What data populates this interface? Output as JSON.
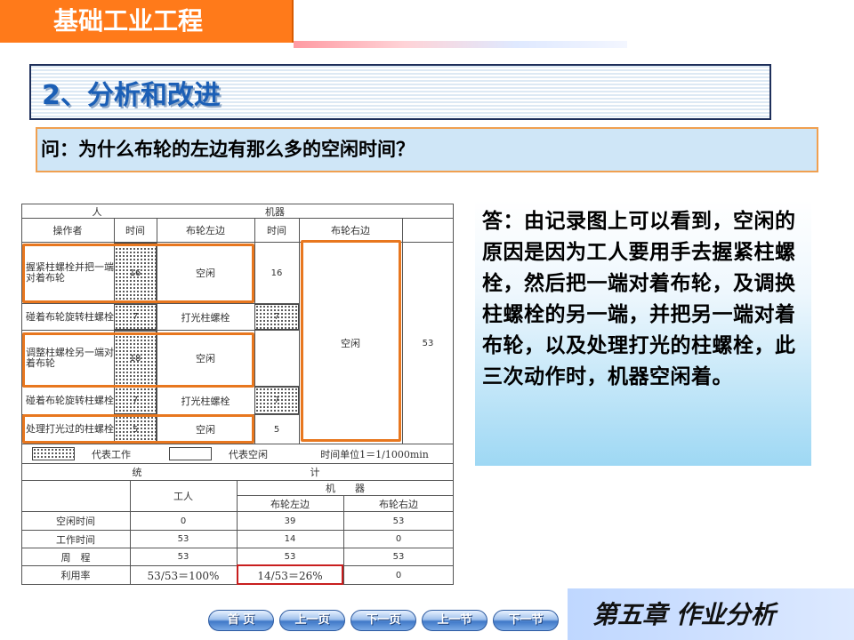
{
  "course_title": "基础工业工程",
  "section_title": "2、分析和改进",
  "question": "问：为什么布轮的左边有那么多的空闲时间？",
  "answer": "答：由记录图上可以看到，空闲的原因是因为工人要用手去握紧柱螺栓，然后把一端对着布轮，及调换柱螺栓的另一端，并把另一端对着布轮，以及处理打光的柱螺栓，此三次动作时，机器空闲着。",
  "chart": {
    "header": {
      "worker": "人",
      "machine": "机器",
      "operator": "操作者",
      "time": "时间",
      "wheel_left": "布轮左边",
      "time2": "时间",
      "wheel_right": "布轮右边"
    },
    "rows": [
      {
        "op": "握紧柱螺栓并把一端对着布轮",
        "t": "16",
        "left": "空闲",
        "t2": "16"
      },
      {
        "op": "碰着布轮旋转柱螺栓",
        "t": "7",
        "left": "打光柱螺栓",
        "t2": "7"
      },
      {
        "op": "调整柱螺栓另一端对着布轮",
        "t": "18",
        "left": "空闲",
        "t2": ""
      },
      {
        "op": "碰着布轮旋转柱螺栓",
        "t": "7",
        "left": "打光柱螺栓",
        "t2": "7"
      },
      {
        "op": "处理打光过的柱螺栓",
        "t": "5",
        "left": "空闲",
        "t2": "5"
      }
    ],
    "right_idle": "空闲",
    "right_total": "53",
    "legend": {
      "work": "代表工作",
      "idle": "代表空闲",
      "unit": "时间单位1＝1/1000min"
    },
    "stats": {
      "title_left": "统",
      "title_right": "计",
      "worker": "工人",
      "machine": "机　　器",
      "wheel_left": "布轮左边",
      "wheel_right": "布轮右边",
      "rows": [
        {
          "label": "空闲时间",
          "worker": "0",
          "left": "39",
          "right": "53"
        },
        {
          "label": "工作时间",
          "worker": "53",
          "left": "14",
          "right": "0"
        },
        {
          "label": "周　程",
          "worker": "53",
          "left": "53",
          "right": "53"
        },
        {
          "label": "利用率",
          "worker": "53/53＝100%",
          "left": "14/53＝26%",
          "right": "0"
        }
      ]
    }
  },
  "nav": {
    "home": "首 页",
    "prev_page": "上一页",
    "next_page": "下一页",
    "prev_section": "上一节",
    "next_section": "下一节"
  },
  "chapter": "第五章 作业分析"
}
